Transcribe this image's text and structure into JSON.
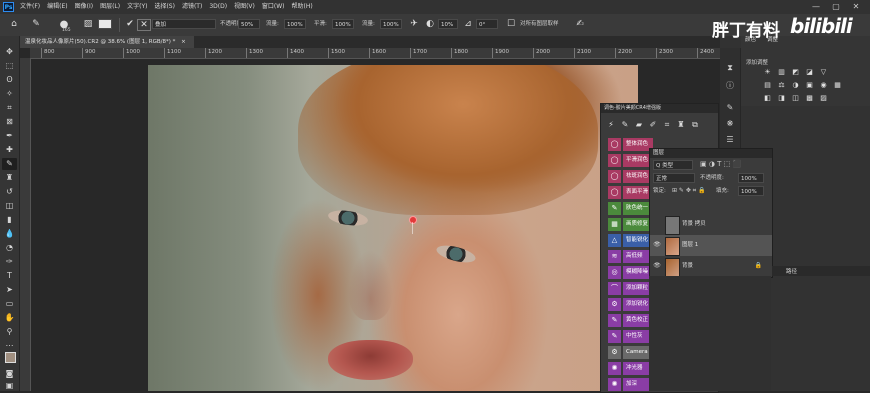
{
  "app": {
    "logo": "Ps",
    "menus": [
      "文件(F)",
      "编辑(E)",
      "图像(I)",
      "图层(L)",
      "文字(Y)",
      "选择(S)",
      "滤镜(T)",
      "3D(D)",
      "视图(V)",
      "窗口(W)",
      "帮助(H)"
    ],
    "window_controls": [
      "—",
      "▢",
      "✕"
    ]
  },
  "options": {
    "brush_size": "165",
    "mode_label": "模式:",
    "mode_value": "正常",
    "mode_dropdown": "叠加",
    "opacity_label": "不透明度:",
    "opacity_value": "50%",
    "flow_label": "流量:",
    "flow_value": "100%",
    "smooth_label": "平滑:",
    "smooth_value": "100%",
    "flow2_label": "流量:",
    "flow2_value": "100%",
    "angle_value": "10%",
    "rotation_value": "0°",
    "sample_label": "对所有图层取样",
    "blend_short": "颜色",
    "edge_label": "描边:"
  },
  "document": {
    "tab_title": "温泉化妆品人像原片(50).CR2 @ 38.6% (图层 1, RGB/8*) *",
    "close": "×"
  },
  "ruler": {
    "h_ticks": [
      "800",
      "900",
      "1000",
      "1100",
      "1200",
      "1300",
      "1400",
      "1500",
      "1600",
      "1700",
      "1800",
      "1900",
      "2000",
      "2100",
      "2200",
      "2300",
      "2400"
    ]
  },
  "adjustments": {
    "tabs": [
      "颜色",
      "调整"
    ],
    "title": "添加调整",
    "row1": [
      "☀",
      "▥",
      "◩",
      "◪",
      "▽"
    ],
    "row2": [
      "▤",
      "⚖",
      "◑",
      "▣",
      "◉",
      "▦"
    ],
    "row3": [
      "◧",
      "◨",
      "◫",
      "▩",
      "▨"
    ]
  },
  "brand": {
    "text": "胖丁有料",
    "logo": "bilibili"
  },
  "actions": {
    "title": "调色-胶片美颜CR4增强版",
    "items": [
      {
        "label": "整体润色",
        "color": "#a93a63",
        "icon": "◯"
      },
      {
        "label": "平滑润色",
        "color": "#a93a63",
        "icon": "◯"
      },
      {
        "label": "祛斑润色",
        "color": "#a93a63",
        "icon": "◯"
      },
      {
        "label": "表面平滑",
        "color": "#a93a63",
        "icon": "◯"
      },
      {
        "label": "肤色统一",
        "color": "#4b8a3c",
        "icon": "✎"
      },
      {
        "label": "画质修复",
        "color": "#4b8a3c",
        "icon": "▦"
      },
      {
        "label": "智能锐化",
        "color": "#3a5fa8",
        "icon": "△"
      },
      {
        "label": "高低频",
        "color": "#8a3da5",
        "icon": "≋"
      },
      {
        "label": "模糊降噪",
        "color": "#8a3da5",
        "icon": "◎"
      },
      {
        "label": "添加颗粒",
        "color": "#8a3da5",
        "icon": "⌒"
      },
      {
        "label": "添加锐化",
        "color": "#8a3da5",
        "icon": "⚙"
      },
      {
        "label": "黄色校正",
        "color": "#8a3da5",
        "icon": "✎"
      },
      {
        "label": "中性灰",
        "color": "#8a3da5",
        "icon": "✎"
      },
      {
        "label": "Camera Raw",
        "color": "#6a6a6a",
        "icon": "⚙"
      },
      {
        "label": "冲光器",
        "color": "#8a3da5",
        "icon": "✺"
      },
      {
        "label": "加深",
        "color": "#8a3da5",
        "icon": "✺"
      }
    ]
  },
  "layers": {
    "tab": "图层",
    "filter_label": "Q 类型",
    "blend": "正常",
    "opacity_label": "不透明度:",
    "opacity_value": "100%",
    "lock_label": "锁定:",
    "fill_label": "填充:",
    "fill_value": "100%",
    "rows": [
      {
        "name": "背景 拷贝",
        "visible": "",
        "selected": false,
        "lock": ""
      },
      {
        "name": "图层 1",
        "visible": "👁",
        "selected": true,
        "lock": ""
      },
      {
        "name": "背景",
        "visible": "👁",
        "selected": false,
        "lock": "🔒"
      }
    ],
    "path_tab": "路径"
  }
}
